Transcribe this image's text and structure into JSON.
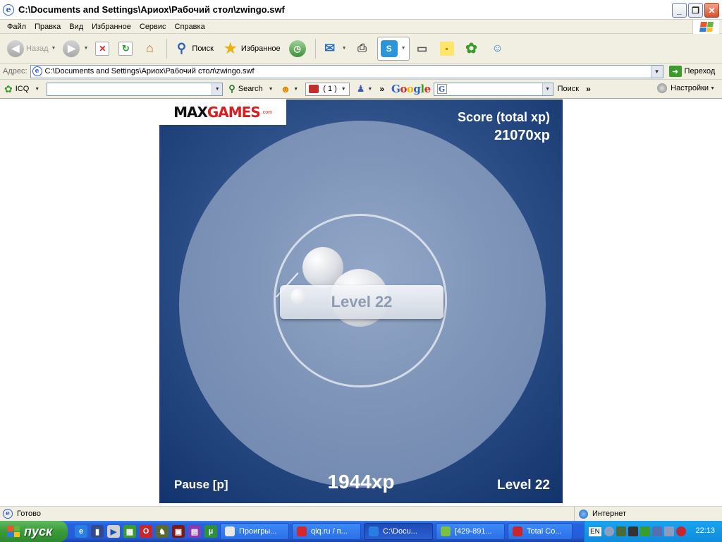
{
  "window": {
    "title": "C:\\Documents and Settings\\Ариох\\Рабочий стол\\zwingo.swf",
    "minimize_glyph": "_",
    "maximize_glyph": "❐",
    "close_glyph": "✕"
  },
  "menu": {
    "items": [
      "Файл",
      "Правка",
      "Вид",
      "Избранное",
      "Сервис",
      "Справка"
    ]
  },
  "toolbar": {
    "back_label": "Назад",
    "search_label": "Поиск",
    "favorites_label": "Избранное"
  },
  "address": {
    "label": "Адрес:",
    "value": "C:\\Documents and Settings\\Ариох\\Рабочий стол\\zwingo.swf",
    "go_label": "Переход"
  },
  "gbar": {
    "icq_label": "ICQ",
    "search_label": "Search",
    "counter_label": "( 1 )",
    "google_search_label": "Поиск",
    "settings_label": "Настройки"
  },
  "game": {
    "logo_part_a": "MAX",
    "logo_part_b": "GAMES",
    "logo_suffix": ".com",
    "score_label": "Score (total xp)",
    "score_value": "21070xp",
    "level_banner": "Level 22",
    "pause_label": "Pause [p]",
    "level_xp": "1944xp",
    "level_corner": "Level 22"
  },
  "status": {
    "text": "Готово",
    "zone": "Интернет"
  },
  "taskbar": {
    "start_label": "пуск",
    "tasks": [
      {
        "label": "Проигры...",
        "color": "#e8e8e8"
      },
      {
        "label": "qiq.ru / п...",
        "color": "#d8262e"
      },
      {
        "label": "C:\\Docu...",
        "color": "#2a7de1"
      },
      {
        "label": "[429-891...",
        "color": "#7cc043"
      },
      {
        "label": "Total Co...",
        "color": "#c8252e"
      }
    ],
    "lang": "EN",
    "clock": "22:13"
  },
  "colors": {
    "game_bg": "#1e3f78",
    "accent_red": "#d81f1f"
  }
}
